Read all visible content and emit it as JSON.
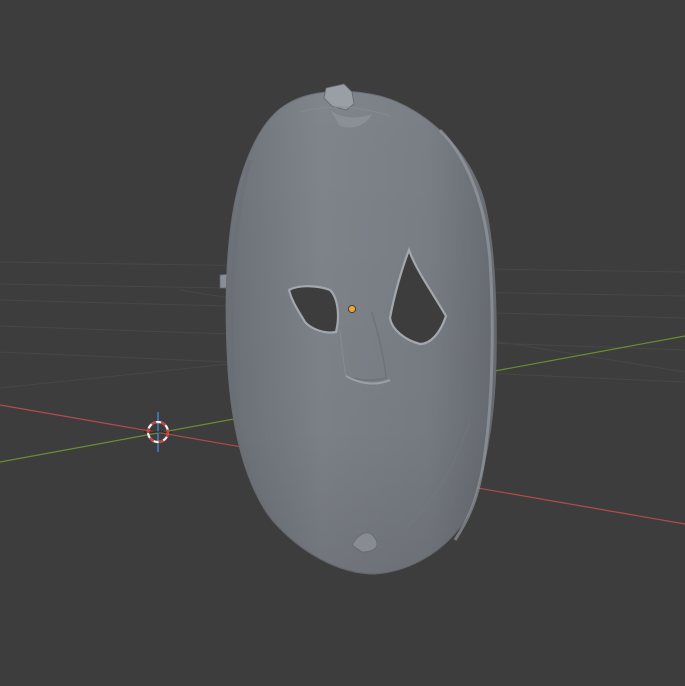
{
  "viewport": {
    "background_color": "#3d3d3d",
    "grid_color": "#454545",
    "x_axis_color": "#b54b4b",
    "y_axis_color": "#6b8e2f",
    "z_axis_color": "#4a7fc4"
  },
  "object": {
    "mesh_color": "#7b8087",
    "shadow_color": "#5f6369",
    "highlight_color": "#8e939a",
    "origin_color": "#e8a63a"
  },
  "cursor": {
    "icon": "3d-cursor-icon",
    "ring_color_a": "#d43c3c",
    "ring_color_b": "#f2f2f2"
  }
}
